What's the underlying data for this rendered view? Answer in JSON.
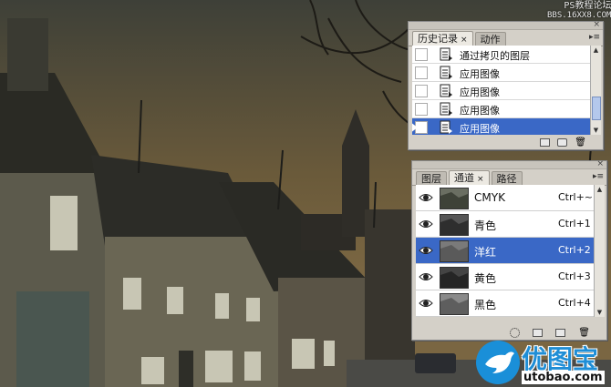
{
  "watermark_top": {
    "line1": "PS教程论坛",
    "line2": "BBS.16XX8.COM"
  },
  "history_panel": {
    "tabs": [
      {
        "label": "历史记录",
        "close": "×"
      },
      {
        "label": "动作"
      }
    ],
    "items": [
      {
        "label": "通过拷贝的图层",
        "selected": false
      },
      {
        "label": "应用图像",
        "selected": false
      },
      {
        "label": "应用图像",
        "selected": false
      },
      {
        "label": "应用图像",
        "selected": false
      },
      {
        "label": "应用图像",
        "selected": true
      }
    ],
    "scroll_position": 0.85
  },
  "channels_panel": {
    "tabs": [
      {
        "label": "图层"
      },
      {
        "label": "通道",
        "close": "×"
      },
      {
        "label": "路径"
      }
    ],
    "channels": [
      {
        "name": "CMYK",
        "shortcut": "Ctrl+~",
        "selected": false
      },
      {
        "name": "青色",
        "shortcut": "Ctrl+1",
        "selected": false
      },
      {
        "name": "洋红",
        "shortcut": "Ctrl+2",
        "selected": true
      },
      {
        "name": "黄色",
        "shortcut": "Ctrl+3",
        "selected": false
      },
      {
        "name": "黑色",
        "shortcut": "Ctrl+4",
        "selected": false
      }
    ]
  },
  "logo": {
    "text_cn": "优图宝",
    "text_url": "utobao.com"
  },
  "colors": {
    "selection": "#3a68c6",
    "panel_bg": "#d4d0c8",
    "logo_blue": "#1a8fd8"
  }
}
